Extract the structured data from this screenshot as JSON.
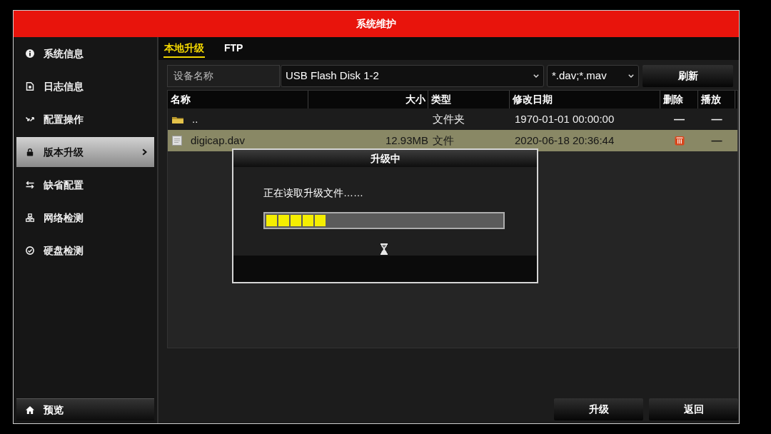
{
  "window": {
    "title": "系统维护"
  },
  "sidebar": {
    "items": [
      {
        "label": "系统信息",
        "selected": false
      },
      {
        "label": "日志信息",
        "selected": false
      },
      {
        "label": "配置操作",
        "selected": false
      },
      {
        "label": "版本升级",
        "selected": true
      },
      {
        "label": "缺省配置",
        "selected": false
      },
      {
        "label": "网络检测",
        "selected": false
      },
      {
        "label": "硬盘检测",
        "selected": false
      }
    ],
    "preview_button": "预览"
  },
  "tabs": [
    {
      "label": "本地升级",
      "selected": true
    },
    {
      "label": "FTP",
      "selected": false
    }
  ],
  "device": {
    "label": "设备名称",
    "value": "USB Flash Disk 1-2",
    "filter": "*.dav;*.mav",
    "refresh_button": "刷新"
  },
  "table": {
    "columns": [
      "名称",
      "大小",
      "类型",
      "修改日期",
      "删除",
      "播放"
    ],
    "rows": [
      {
        "kind": "folder",
        "selected": false,
        "name": "..",
        "type": "文件夹",
        "modified": "1970-01-01 00:00:00",
        "delete": {
          "kind": "dash",
          "text": "—"
        },
        "play": "—"
      },
      {
        "kind": "file",
        "selected": true,
        "name": "digicap.dav",
        "size": "12.93MB",
        "type": "文件",
        "modified": "2020-06-18 20:36:44",
        "delete": {
          "kind": "trash"
        },
        "play": "—"
      }
    ]
  },
  "dialog": {
    "title": "升级中",
    "message": "正在读取升级文件……",
    "progress": {
      "level": 0.25
    }
  },
  "buttons": [
    "升级",
    "返回"
  ]
}
